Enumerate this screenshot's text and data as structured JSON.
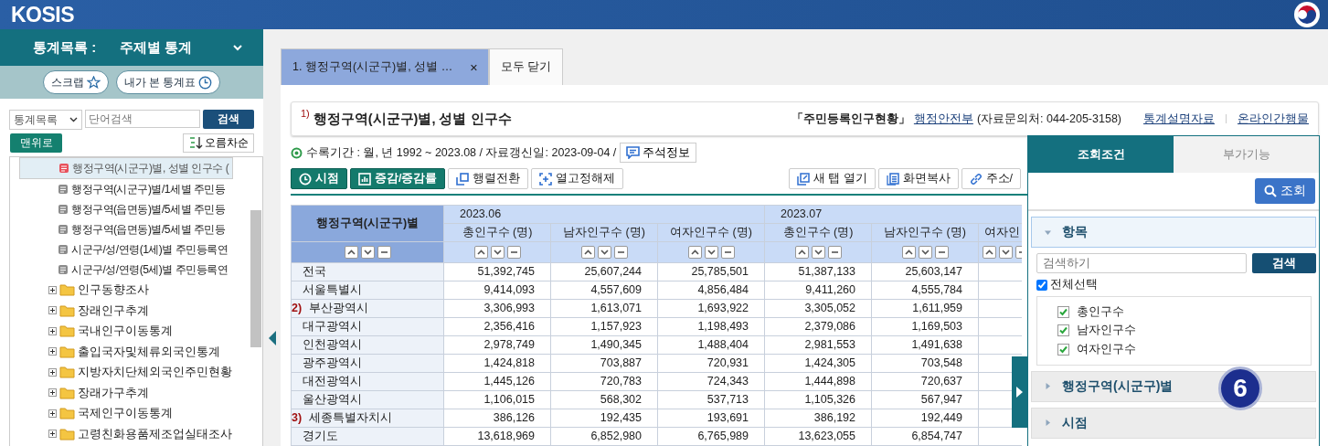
{
  "header": {
    "logo": "KOSIS"
  },
  "sidebar": {
    "catalog_label": "통계목록 :",
    "catalog_value": "주제별 통계",
    "pill_buttons": [
      {
        "label": "스크랩",
        "kind": "star"
      },
      {
        "label": "내가 본 통계표",
        "kind": "clock"
      }
    ],
    "search": {
      "select": "통계목록",
      "placeholder": "단어검색",
      "button": "검색"
    },
    "top_button": "맨위로",
    "sort_button": "오름차순",
    "tree": {
      "open_tables": [
        {
          "label": "행정구역(시군구)별, 성별 인구수 (",
          "selected": true
        },
        {
          "label": "행정구역(시군구)별/1세별 주민등",
          "selected": false
        },
        {
          "label": "행정구역(읍면동)별/5세별 주민등",
          "selected": false
        },
        {
          "label": "행정구역(읍면동)별/5세별 주민등",
          "selected": false
        },
        {
          "label": "시군구/성/연령(1세)별 주민등록연",
          "selected": false
        },
        {
          "label": "시군구/성/연령(5세)별 주민등록연",
          "selected": false
        }
      ],
      "folders": [
        {
          "label": "인구동향조사",
          "expanded": false
        },
        {
          "label": "장래인구추계",
          "expanded": false
        },
        {
          "label": "국내인구이동통계",
          "expanded": false
        },
        {
          "label": "출입국자및체류외국인통계",
          "expanded": false
        },
        {
          "label": "지방자치단체외국인주민현황",
          "expanded": false
        },
        {
          "label": "장래가구추계",
          "expanded": false
        },
        {
          "label": "국제인구이동통계",
          "expanded": false
        },
        {
          "label": "고령친화용품제조업실태조사",
          "expanded": false
        }
      ]
    }
  },
  "tabs": [
    {
      "label": "1. 행정구역(시군구)별, 성별 …",
      "selected": true,
      "closable": true
    },
    {
      "label": "모두 닫기",
      "selected": false,
      "closable": false
    }
  ],
  "table_title": {
    "note": "1)",
    "title": "행정구역(시군구)별, 성별 인구수",
    "survey": "「주민등록인구현황」",
    "agency": "행정안전부",
    "contact": "(자료문의처: 044-205-3158)",
    "links": [
      "통계설명자료",
      "온라인간행물"
    ]
  },
  "info": {
    "text": "수록기간 : 월, 년 1992 ~ 2023.08 / 자료갱신일: 2023-09-04 /",
    "button": "주석정보"
  },
  "toolbar_left": [
    {
      "label": "시점",
      "kind": "clock",
      "primary": true
    },
    {
      "label": "증감/증감률",
      "kind": "chart",
      "primary": true
    },
    {
      "label": "행렬전환",
      "kind": "swap",
      "primary": false
    },
    {
      "label": "열고정해제",
      "kind": "unlock",
      "primary": false
    }
  ],
  "toolbar_right": [
    {
      "label": "새 탭 열기",
      "kind": "newtab"
    },
    {
      "label": "화면복사",
      "kind": "copy"
    },
    {
      "label": "주소/",
      "kind": "link"
    }
  ],
  "table": {
    "row_header": "행정구역(시군구)별",
    "periods": [
      {
        "label": "2023.06",
        "items": [
          "총인구수 (명)",
          "남자인구수 (명)",
          "여자인구수 (명)"
        ]
      },
      {
        "label": "2023.07",
        "items": [
          "총인구수 (명)",
          "남자인구수 (명)",
          "여자인"
        ]
      }
    ],
    "rows": [
      {
        "name": "전국",
        "values": [
          "51,392,745",
          "25,607,244",
          "25,785,501",
          "51,387,133",
          "25,603,147"
        ]
      },
      {
        "name": "서울특별시",
        "values": [
          "9,414,093",
          "4,557,609",
          "4,856,484",
          "9,411,260",
          "4,555,784"
        ]
      },
      {
        "note": "2)",
        "name": "부산광역시",
        "values": [
          "3,306,993",
          "1,613,071",
          "1,693,922",
          "3,305,052",
          "1,611,959"
        ]
      },
      {
        "name": "대구광역시",
        "values": [
          "2,356,416",
          "1,157,923",
          "1,198,493",
          "2,379,086",
          "1,169,503"
        ]
      },
      {
        "name": "인천광역시",
        "values": [
          "2,978,749",
          "1,490,345",
          "1,488,404",
          "2,981,553",
          "1,491,638"
        ]
      },
      {
        "name": "광주광역시",
        "values": [
          "1,424,818",
          "703,887",
          "720,931",
          "1,424,305",
          "703,548"
        ]
      },
      {
        "name": "대전광역시",
        "values": [
          "1,445,126",
          "720,783",
          "724,343",
          "1,444,898",
          "720,637"
        ]
      },
      {
        "name": "울산광역시",
        "values": [
          "1,106,015",
          "568,302",
          "537,713",
          "1,105,326",
          "567,947"
        ]
      },
      {
        "note": "3)",
        "name": "세종특별자치시",
        "values": [
          "386,126",
          "192,435",
          "193,691",
          "386,192",
          "192,449"
        ]
      },
      {
        "name": "경기도",
        "values": [
          "13,618,969",
          "6,852,980",
          "6,765,989",
          "13,623,055",
          "6,854,747"
        ]
      }
    ]
  },
  "panel": {
    "tabs": [
      {
        "label": "조회조건",
        "selected": true
      },
      {
        "label": "부가기능",
        "selected": false
      }
    ],
    "query_button": "조회",
    "sections": [
      {
        "label": "항목",
        "expanded": true
      },
      {
        "label": "행정구역(시군구)별",
        "expanded": false
      },
      {
        "label": "시점",
        "expanded": false
      }
    ],
    "item_search": {
      "placeholder": "검색하기",
      "button": "검색"
    },
    "select_all": {
      "label": "전체선택",
      "checked": true
    },
    "items": [
      {
        "label": "총인구수",
        "checked": true
      },
      {
        "label": "남자인구수",
        "checked": true
      },
      {
        "label": "여자인구수",
        "checked": true
      }
    ]
  },
  "step_badge": "6"
}
